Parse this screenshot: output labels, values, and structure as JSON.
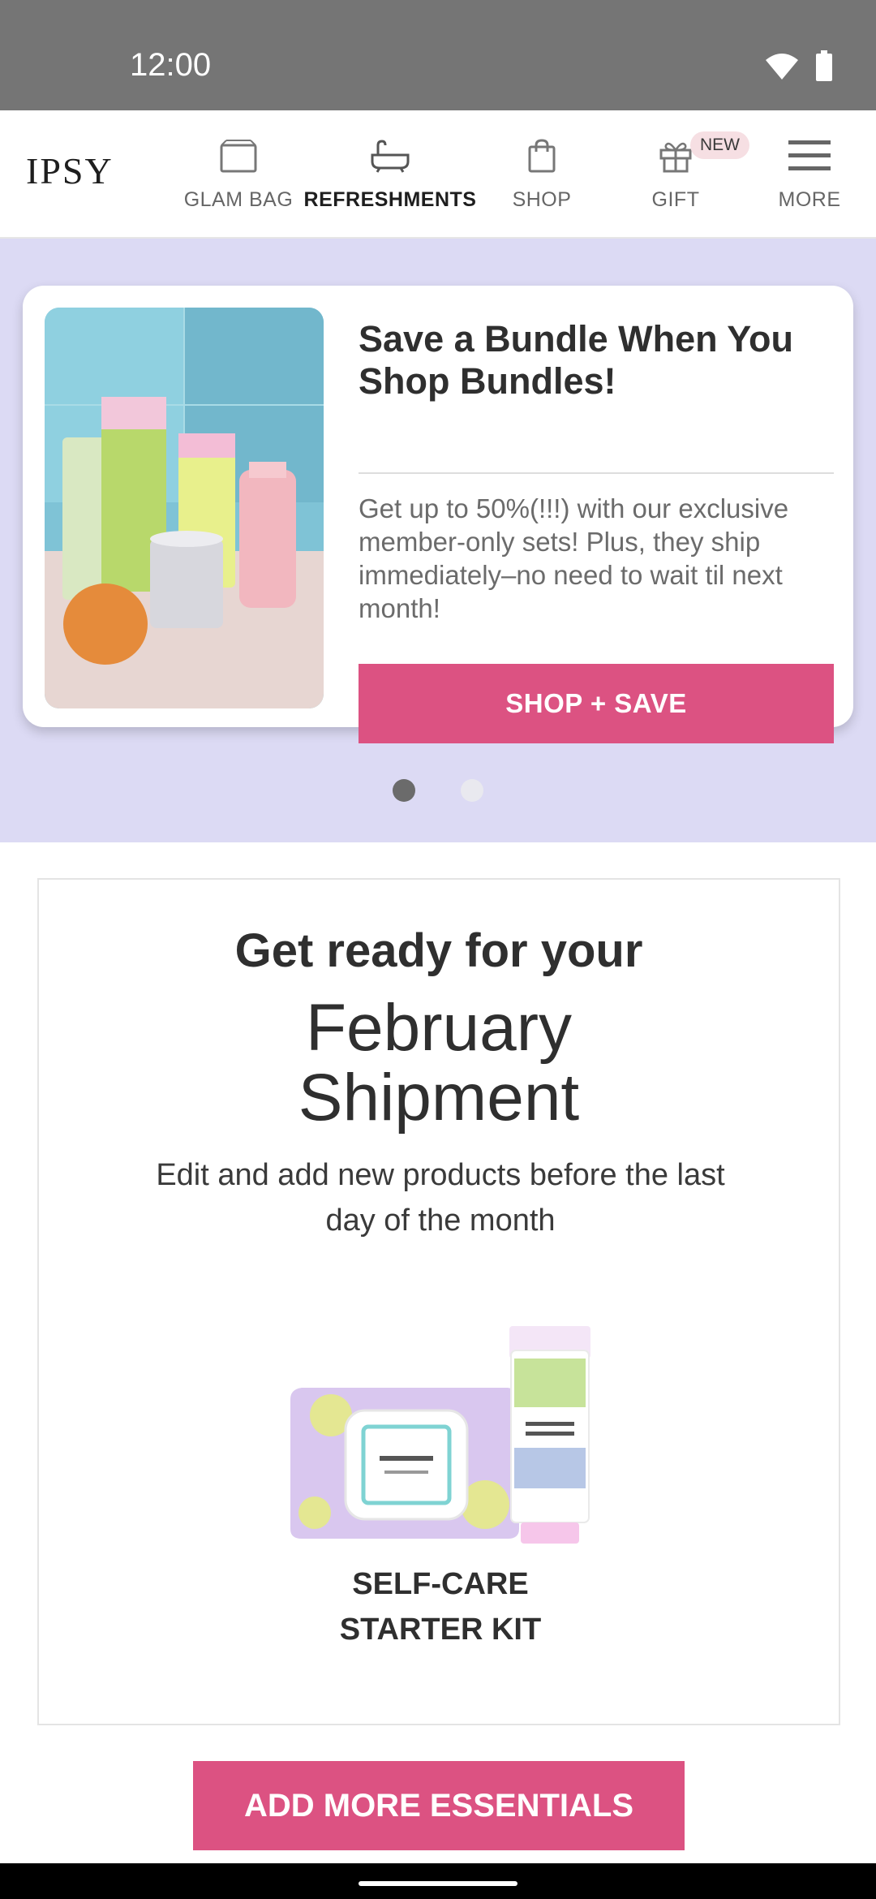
{
  "status_bar": {
    "time": "12:00",
    "icons": [
      "wifi-icon",
      "battery-icon"
    ]
  },
  "header": {
    "logo": "IPSY",
    "nav": [
      {
        "label": "GLAM BAG",
        "icon": "bag-box-icon",
        "active": false
      },
      {
        "label": "REFRESHMENTS",
        "icon": "bathtub-icon",
        "active": true
      },
      {
        "label": "SHOP",
        "icon": "shopping-bag-icon",
        "active": false
      },
      {
        "label": "GIFT",
        "icon": "gift-icon",
        "active": false,
        "badge": "NEW"
      },
      {
        "label": "MORE",
        "icon": "menu-icon",
        "active": false
      }
    ]
  },
  "promo": {
    "title": "Save a Bundle When You Shop Bundles!",
    "body": "Get up to 50%(!!!) with our exclusive member-only sets! Plus, they ship immediately–no need to wait til next month!",
    "button": "SHOP + SAVE",
    "carousel": {
      "active_index": 0,
      "count": 2
    }
  },
  "shipment": {
    "heading": "Get ready for your",
    "month_line1": "February",
    "month_line2": "Shipment",
    "subtitle": "Edit and add new products before the last day of the month",
    "product_name": "SELF-CARE STARTER KIT"
  },
  "bottom_button": "ADD MORE ESSENTIALS",
  "colors": {
    "accent": "#dc5282",
    "promo_bg": "#dcdaf4",
    "status_bar": "#757575"
  }
}
